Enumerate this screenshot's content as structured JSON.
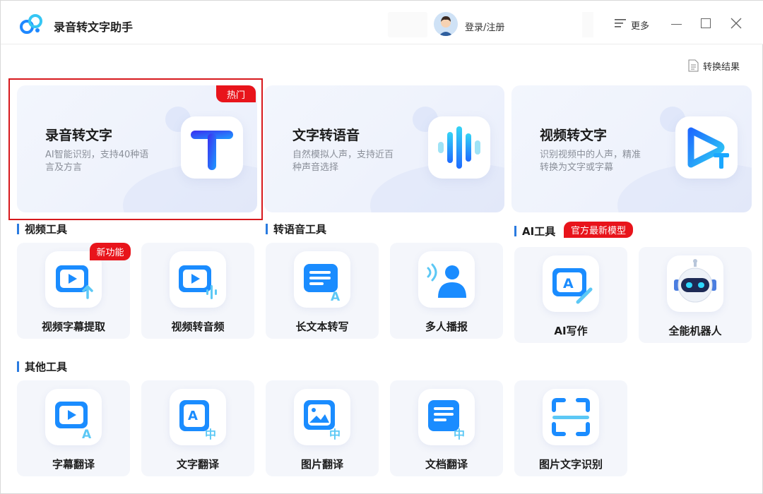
{
  "app": {
    "title": "录音转文字助手"
  },
  "header": {
    "login_label": "登录/注册",
    "more_label": "更多"
  },
  "toolbar": {
    "result_label": "转换结果"
  },
  "features": [
    {
      "title": "录音转文字",
      "desc": "AI智能识别，支持40种语言及方言",
      "badge": "热门",
      "icon": "text-t-icon"
    },
    {
      "title": "文字转语音",
      "desc": "自然模拟人声，支持近百种声音选择",
      "icon": "sound-wave-icon"
    },
    {
      "title": "视频转文字",
      "desc": "识别视频中的人声，精准转换为文字或字幕",
      "icon": "video-text-icon"
    }
  ],
  "sections": {
    "video_tools": {
      "label": "视频工具",
      "tools": [
        {
          "label": "视频字幕提取",
          "badge": "新功能"
        },
        {
          "label": "视频转音频"
        }
      ]
    },
    "tts_tools": {
      "label": "转语音工具",
      "tools": [
        {
          "label": "长文本转写"
        },
        {
          "label": "多人播报"
        }
      ]
    },
    "ai_tools": {
      "label": "AI工具",
      "badge": "官方最新模型",
      "tools": [
        {
          "label": "AI写作"
        },
        {
          "label": "全能机器人"
        }
      ]
    },
    "other_tools": {
      "label": "其他工具",
      "tools": [
        {
          "label": "字幕翻译"
        },
        {
          "label": "文字翻译"
        },
        {
          "label": "图片翻译"
        },
        {
          "label": "文档翻译"
        },
        {
          "label": "图片文字识别"
        }
      ]
    }
  },
  "colors": {
    "accent": "#2a7be0",
    "badge_red": "#e8141b",
    "card_bg": "#f4f6fb"
  }
}
